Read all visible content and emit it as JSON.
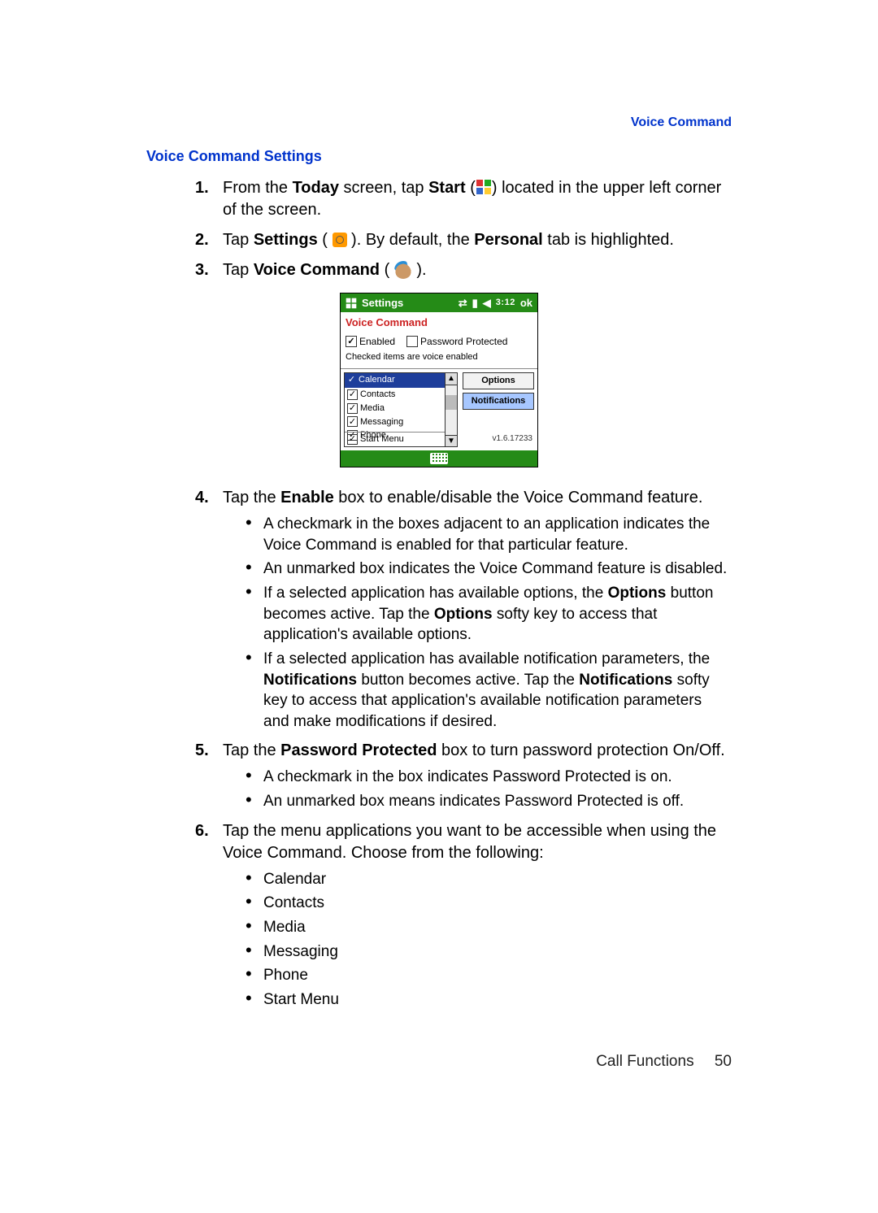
{
  "header": {
    "right": "Voice Command"
  },
  "section_heading": "Voice Command Settings",
  "steps": {
    "s1": {
      "num": "1.",
      "pre": "From the ",
      "today": "Today",
      "mid": " screen, tap ",
      "start": "Start",
      "post_icon": " located in the upper left corner of the screen."
    },
    "s2": {
      "num": "2.",
      "pre": "Tap ",
      "settings": "Settings",
      "post_icon": ". By default, the ",
      "personal": "Personal",
      "post": " tab is highlighted."
    },
    "s3": {
      "num": "3.",
      "pre": "Tap ",
      "voice": "Voice Command",
      "post": "."
    },
    "s4": {
      "num": "4.",
      "pre": "Tap the ",
      "enable": "Enable",
      "post": " box to enable/disable the Voice Command feature.",
      "b1": "A checkmark in the boxes adjacent to an application indicates the Voice Command is enabled for that particular feature.",
      "b2": "An unmarked box indicates the Voice Command feature is disabled.",
      "b3a": "If a selected application has available options, the ",
      "b3b": "Options",
      "b3c": " button becomes active. Tap the ",
      "b3d": "Options",
      "b3e": " softy key to access that application's available options.",
      "b4a": "If a selected application has available notification parameters, the ",
      "b4b": "Notifications",
      "b4c": " button becomes active. Tap the ",
      "b4d": "Notifications",
      "b4e": " softy key to access that application's available notification parameters and make modifications if desired."
    },
    "s5": {
      "num": "5.",
      "pre": "Tap the ",
      "pw": "Password Protected",
      "post": " box to turn password protection On/Off.",
      "b1": "A checkmark in the box indicates Password Protected is on.",
      "b2": "An unmarked box means indicates Password Protected is off."
    },
    "s6": {
      "num": "6.",
      "text": "Tap the menu applications you want to be accessible when using the Voice Command. Choose from the following:",
      "items": [
        "Calendar",
        "Contacts",
        "Media",
        "Messaging",
        "Phone",
        "Start Menu"
      ]
    }
  },
  "phone": {
    "title": "Settings",
    "time": "3:12",
    "ok": "ok",
    "subtitle": "Voice Command",
    "enabled_label": "Enabled",
    "pw_label": "Password Protected",
    "note": "Checked items are voice enabled",
    "list": [
      "Calendar",
      "Contacts",
      "Media",
      "Messaging",
      "Phone",
      "Start Menu"
    ],
    "btn_options": "Options",
    "btn_notifications": "Notifications",
    "version": "v1.6.17233"
  },
  "footer": {
    "section": "Call Functions",
    "page": "50"
  }
}
